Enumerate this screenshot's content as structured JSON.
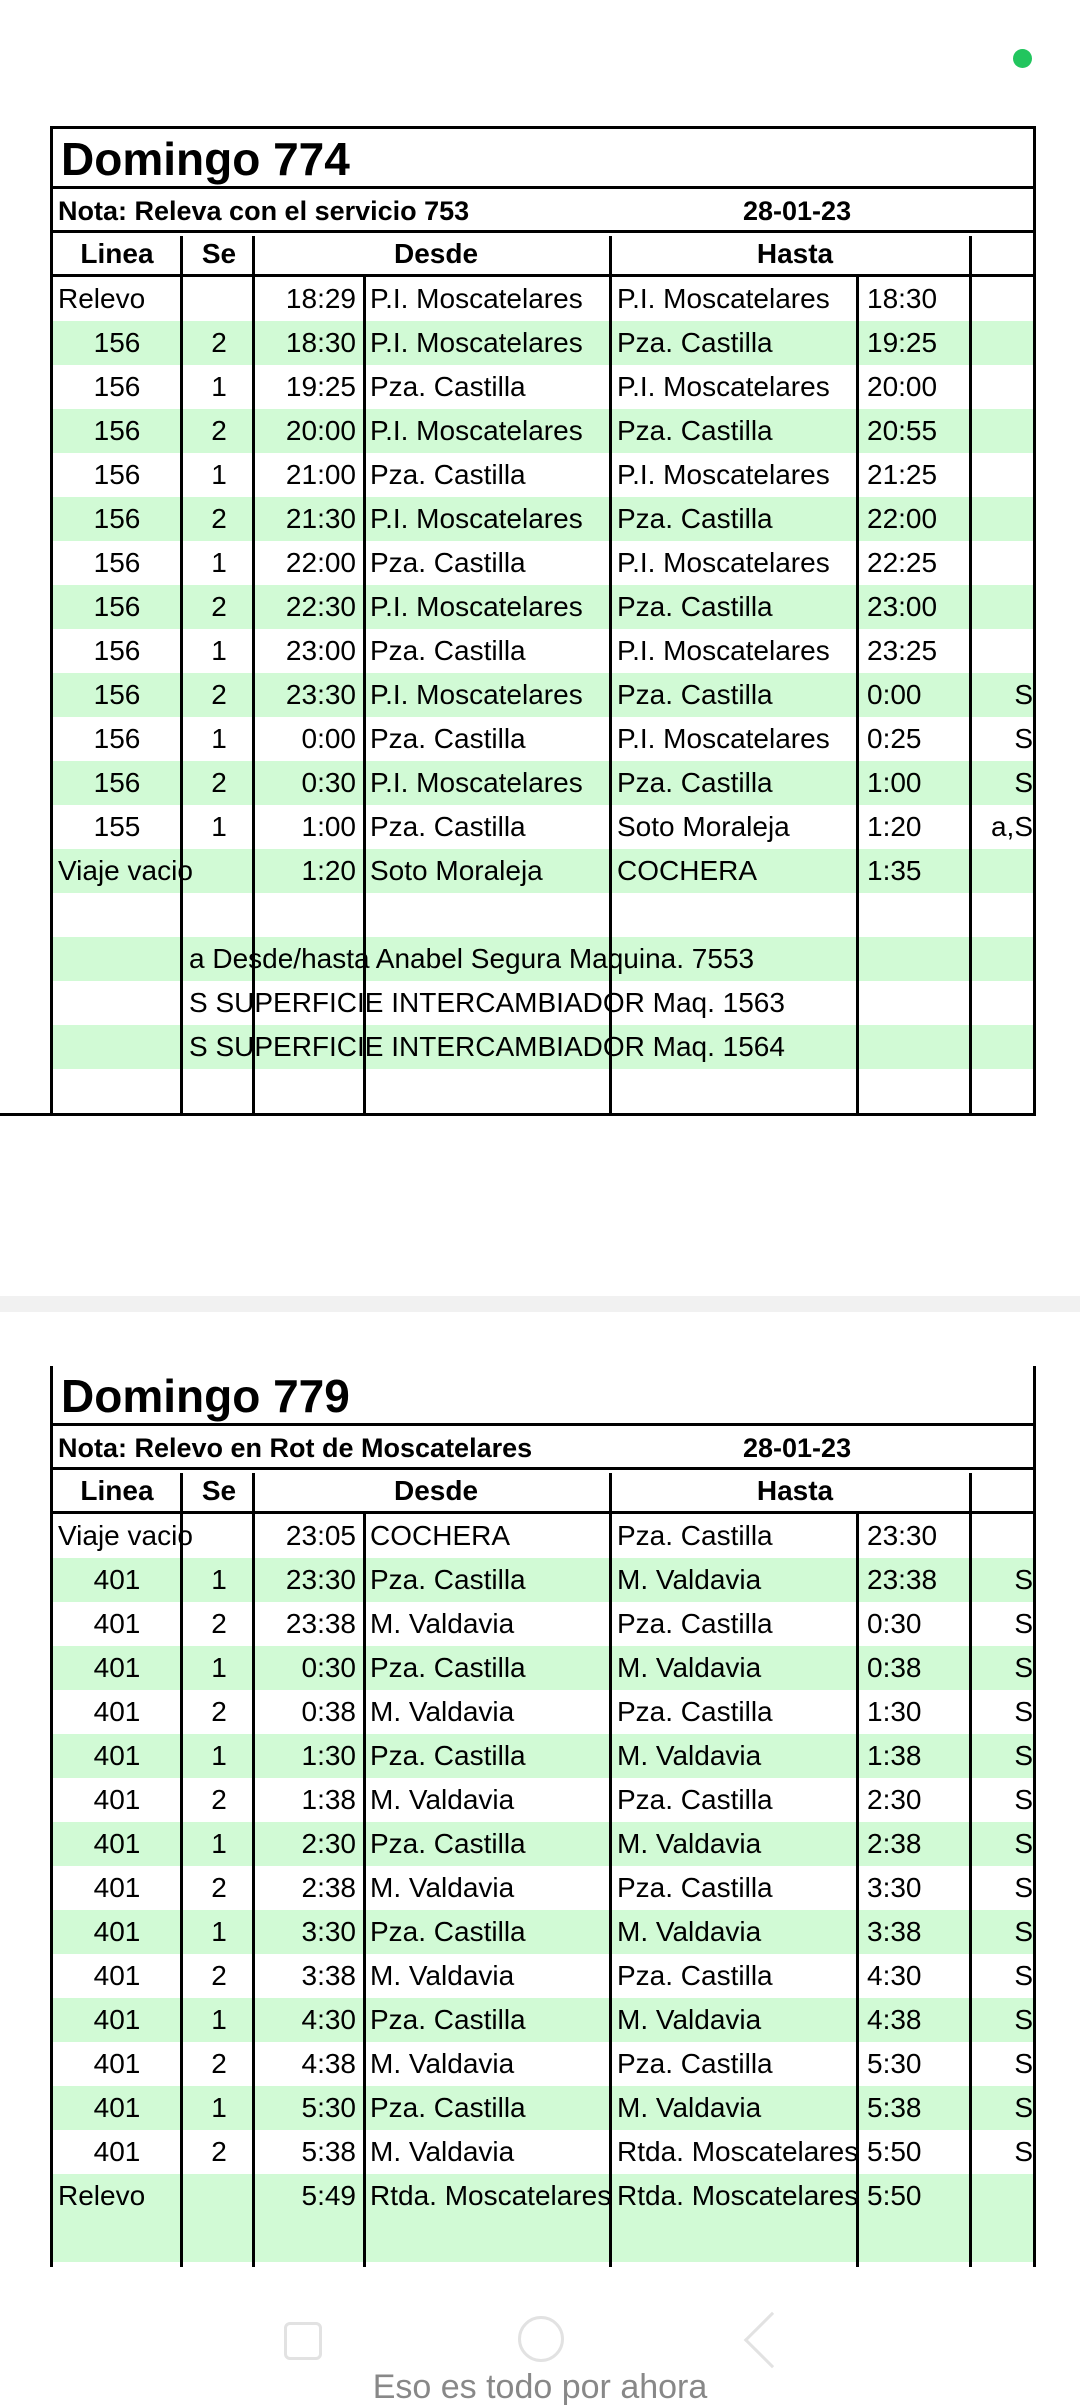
{
  "sheet1": {
    "title": "Domingo 774",
    "note": "Nota: Releva con el servicio 753",
    "date": "28-01-23",
    "headers": {
      "linea": "Linea",
      "se": "Se",
      "desde": "Desde",
      "hasta": "Hasta"
    },
    "rows": [
      {
        "linea": "Relevo",
        "se": "",
        "t1": "18:29",
        "desde": "P.I. Moscatelares",
        "hasta": "P.I. Moscatelares",
        "t2": "18:30",
        "flag": ""
      },
      {
        "linea": "156",
        "se": "2",
        "t1": "18:30",
        "desde": "P.I. Moscatelares",
        "hasta": "Pza. Castilla",
        "t2": "19:25",
        "flag": ""
      },
      {
        "linea": "156",
        "se": "1",
        "t1": "19:25",
        "desde": "Pza. Castilla",
        "hasta": "P.I. Moscatelares",
        "t2": "20:00",
        "flag": ""
      },
      {
        "linea": "156",
        "se": "2",
        "t1": "20:00",
        "desde": "P.I. Moscatelares",
        "hasta": "Pza. Castilla",
        "t2": "20:55",
        "flag": ""
      },
      {
        "linea": "156",
        "se": "1",
        "t1": "21:00",
        "desde": "Pza. Castilla",
        "hasta": "P.I. Moscatelares",
        "t2": "21:25",
        "flag": ""
      },
      {
        "linea": "156",
        "se": "2",
        "t1": "21:30",
        "desde": "P.I. Moscatelares",
        "hasta": "Pza. Castilla",
        "t2": "22:00",
        "flag": ""
      },
      {
        "linea": "156",
        "se": "1",
        "t1": "22:00",
        "desde": "Pza. Castilla",
        "hasta": "P.I. Moscatelares",
        "t2": "22:25",
        "flag": ""
      },
      {
        "linea": "156",
        "se": "2",
        "t1": "22:30",
        "desde": "P.I. Moscatelares",
        "hasta": "Pza. Castilla",
        "t2": "23:00",
        "flag": ""
      },
      {
        "linea": "156",
        "se": "1",
        "t1": "23:00",
        "desde": "Pza. Castilla",
        "hasta": "P.I. Moscatelares",
        "t2": "23:25",
        "flag": ""
      },
      {
        "linea": "156",
        "se": "2",
        "t1": "23:30",
        "desde": "P.I. Moscatelares",
        "hasta": "Pza. Castilla",
        "t2": "0:00",
        "flag": "S"
      },
      {
        "linea": "156",
        "se": "1",
        "t1": "0:00",
        "desde": "Pza. Castilla",
        "hasta": "P.I. Moscatelares",
        "t2": "0:25",
        "flag": "S"
      },
      {
        "linea": "156",
        "se": "2",
        "t1": "0:30",
        "desde": "P.I. Moscatelares",
        "hasta": "Pza. Castilla",
        "t2": "1:00",
        "flag": "S"
      },
      {
        "linea": "155",
        "se": "1",
        "t1": "1:00",
        "desde": "Pza. Castilla",
        "hasta": "Soto Moraleja",
        "t2": "1:20",
        "flag": "a,S"
      },
      {
        "linea": "Viaje vacio",
        "se": "",
        "t1": "1:20",
        "desde": "Soto Moraleja",
        "hasta": "COCHERA",
        "t2": "1:35",
        "flag": ""
      }
    ],
    "notes": [
      "a Desde/hasta Anabel Segura Maquina. 7553",
      "S SUPERFICIE INTERCAMBIADOR Maq. 1563",
      "S SUPERFICIE INTERCAMBIADOR Maq. 1564"
    ]
  },
  "sheet2": {
    "title": "Domingo 779",
    "note": "Nota: Relevo en Rot de Moscatelares",
    "date": "28-01-23",
    "headers": {
      "linea": "Linea",
      "se": "Se",
      "desde": "Desde",
      "hasta": "Hasta"
    },
    "rows": [
      {
        "linea": "Viaje vacio",
        "se": "",
        "t1": "23:05",
        "desde": "COCHERA",
        "hasta": "Pza. Castilla",
        "t2": "23:30",
        "flag": ""
      },
      {
        "linea": "401",
        "se": "1",
        "t1": "23:30",
        "desde": "Pza. Castilla",
        "hasta": "M. Valdavia",
        "t2": "23:38",
        "flag": "S"
      },
      {
        "linea": "401",
        "se": "2",
        "t1": "23:38",
        "desde": "M. Valdavia",
        "hasta": "Pza. Castilla",
        "t2": "0:30",
        "flag": "S"
      },
      {
        "linea": "401",
        "se": "1",
        "t1": "0:30",
        "desde": "Pza. Castilla",
        "hasta": "M. Valdavia",
        "t2": "0:38",
        "flag": "S"
      },
      {
        "linea": "401",
        "se": "2",
        "t1": "0:38",
        "desde": "M. Valdavia",
        "hasta": "Pza. Castilla",
        "t2": "1:30",
        "flag": "S"
      },
      {
        "linea": "401",
        "se": "1",
        "t1": "1:30",
        "desde": "Pza. Castilla",
        "hasta": "M. Valdavia",
        "t2": "1:38",
        "flag": "S"
      },
      {
        "linea": "401",
        "se": "2",
        "t1": "1:38",
        "desde": "M. Valdavia",
        "hasta": "Pza. Castilla",
        "t2": "2:30",
        "flag": "S"
      },
      {
        "linea": "401",
        "se": "1",
        "t1": "2:30",
        "desde": "Pza. Castilla",
        "hasta": "M. Valdavia",
        "t2": "2:38",
        "flag": "S"
      },
      {
        "linea": "401",
        "se": "2",
        "t1": "2:38",
        "desde": "M. Valdavia",
        "hasta": "Pza. Castilla",
        "t2": "3:30",
        "flag": "S"
      },
      {
        "linea": "401",
        "se": "1",
        "t1": "3:30",
        "desde": "Pza. Castilla",
        "hasta": "M. Valdavia",
        "t2": "3:38",
        "flag": "S"
      },
      {
        "linea": "401",
        "se": "2",
        "t1": "3:38",
        "desde": "M. Valdavia",
        "hasta": "Pza. Castilla",
        "t2": "4:30",
        "flag": "S"
      },
      {
        "linea": "401",
        "se": "1",
        "t1": "4:30",
        "desde": "Pza. Castilla",
        "hasta": "M. Valdavia",
        "t2": "4:38",
        "flag": "S"
      },
      {
        "linea": "401",
        "se": "2",
        "t1": "4:38",
        "desde": "M. Valdavia",
        "hasta": "Pza. Castilla",
        "t2": "5:30",
        "flag": "S"
      },
      {
        "linea": "401",
        "se": "1",
        "t1": "5:30",
        "desde": "Pza. Castilla",
        "hasta": "M. Valdavia",
        "t2": "5:38",
        "flag": "S"
      },
      {
        "linea": "401",
        "se": "2",
        "t1": "5:38",
        "desde": "M. Valdavia",
        "hasta": "Rtda. Moscatelares",
        "t2": "5:50",
        "flag": "S"
      },
      {
        "linea": "Relevo",
        "se": "",
        "t1": "5:49",
        "desde": "Rtda. Moscatelares",
        "hasta": "Rtda. Moscatelares",
        "t2": "5:50",
        "flag": ""
      }
    ]
  },
  "bottom": {
    "end_text": "Eso es todo por ahora"
  },
  "colors": {
    "row_alt": "#d1fad5",
    "status_dot": "#22c55e"
  }
}
